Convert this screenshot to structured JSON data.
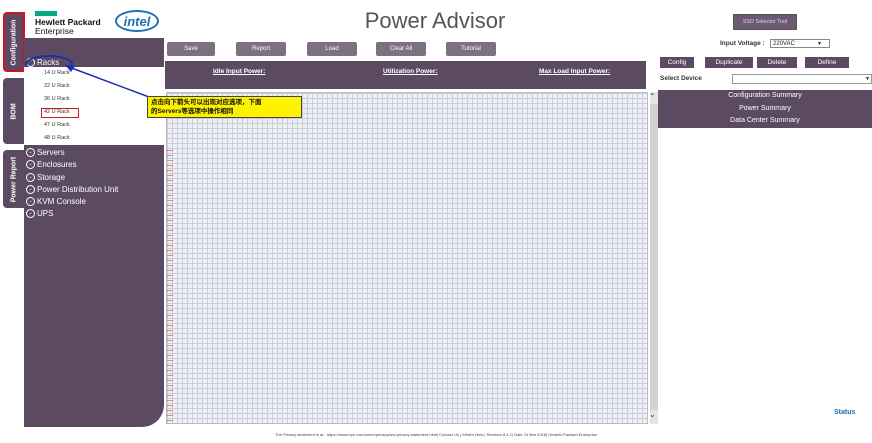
{
  "sidebar_tabs": [
    {
      "label": "Configuration",
      "active": true
    },
    {
      "label": "BOM",
      "active": false
    },
    {
      "label": "Power Report",
      "active": false
    }
  ],
  "header": {
    "brand_line1": "Hewlett Packard",
    "brand_line2": "Enterprise",
    "intel_logo": "intel",
    "title": "Power Advisor",
    "ssd_button": "SSD Selector Tool"
  },
  "left_panel": {
    "racks_label": "Racks",
    "rack_items": [
      "14 U Rack",
      "22 U Rack",
      "36 U Rack",
      "42 U Rack",
      "47 U Rack",
      "48 U Rack"
    ],
    "categories": [
      "Servers",
      "Enclosures",
      "Storage",
      "Power Distribution Unit",
      "KVM Console",
      "UPS"
    ]
  },
  "callout": {
    "text_line1": "点击向下箭头可以出现对应选项，下面",
    "text_line2": "的Servers等选项中操作相同"
  },
  "toolbar": {
    "save": "Save",
    "report": "Report",
    "load": "Load",
    "clear_all": "Clear All",
    "tutorial": "Tutorial"
  },
  "power_bar": {
    "idle": "Idle Input Power:",
    "utilization": "Utilization Power:",
    "max_load": "Max Load Input Power:"
  },
  "right_panel": {
    "input_voltage_label": "Input Voltage :",
    "input_voltage_value": "220VAC",
    "buttons": [
      "Config",
      "Duplicate",
      "Delete",
      "Define"
    ],
    "select_device_label": "Select Device",
    "summaries": [
      "Configuration Summary",
      "Power Summary",
      "Data Center Summary"
    ],
    "status": "Status"
  },
  "footer": "The Privacy statement is at - https://www.hpe.com/us/en/privacy/ww-privacy-statement.html| Contact Us | What's New | Revision 8.4.1| Date 23 Mar 2018| Hewlett-Packard Enterprise",
  "colors": {
    "accent_purple": "#5c4a63",
    "hpe_green": "#01a982",
    "intel_blue": "#1c6fb7",
    "callout_yellow": "#fff200",
    "highlight_red": "#d0141c"
  }
}
